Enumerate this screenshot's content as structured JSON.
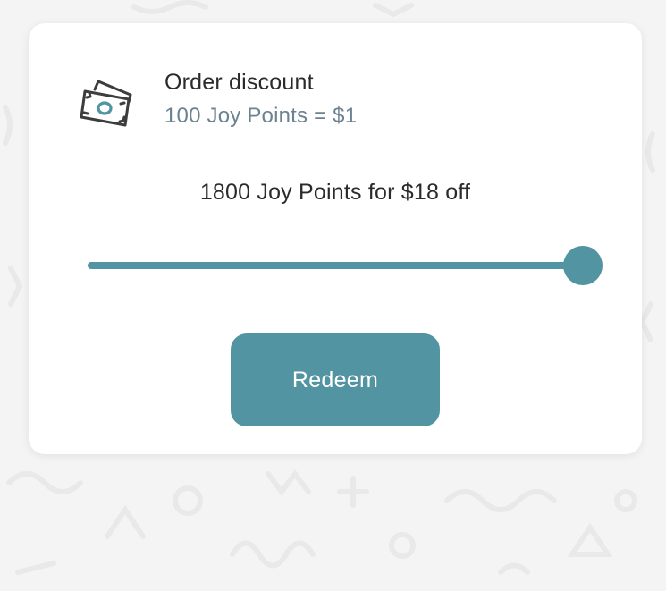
{
  "reward": {
    "icon": "money-bills-icon",
    "title": "Order discount",
    "rate": "100 Joy Points = $1"
  },
  "redemption": {
    "summary": "1800 Joy Points for $18 off",
    "slider_level": 1.0
  },
  "actions": {
    "redeem_label": "Redeem"
  },
  "colors": {
    "accent": "#5294a2",
    "secondary_text": "#6b8290",
    "primary_text": "#2b2b2b",
    "card": "#ffffff",
    "background": "#f4f4f4"
  }
}
